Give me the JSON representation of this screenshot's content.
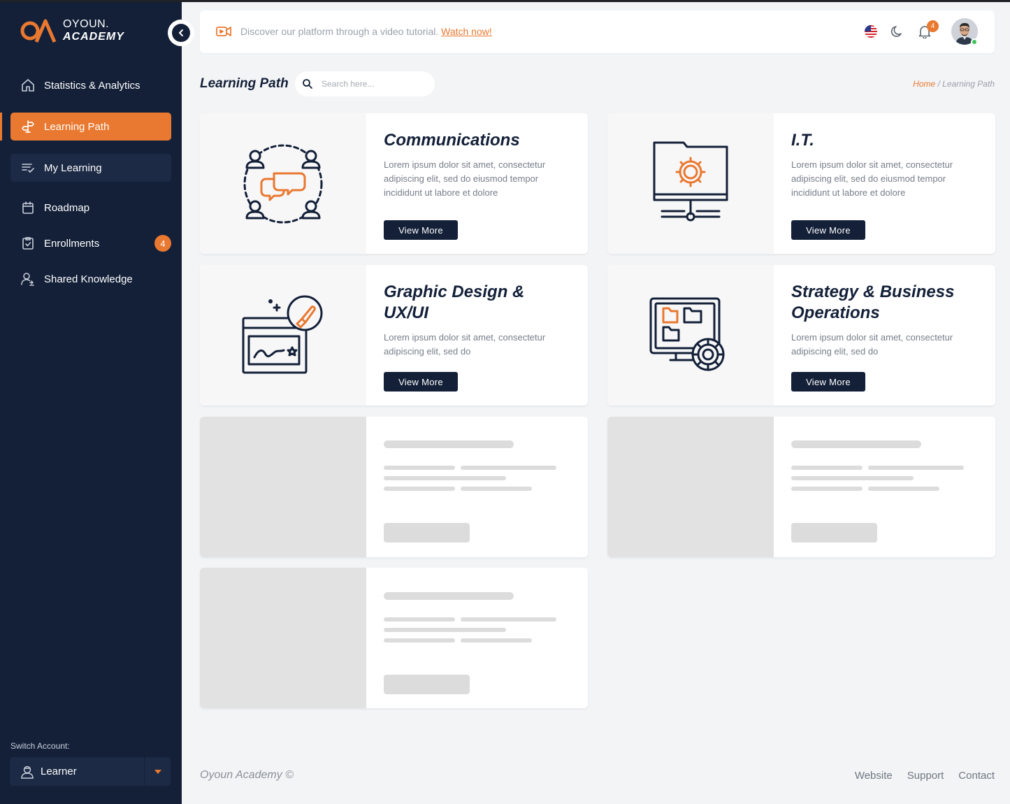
{
  "brand": {
    "line1": "OYOUN.",
    "line2": "ACADEMY"
  },
  "sidebar": {
    "items": [
      {
        "label": "Statistics & Analytics",
        "icon": "home-icon"
      },
      {
        "label": "Learning Path",
        "icon": "signpost-icon",
        "active": true
      },
      {
        "label": "My Learning",
        "icon": "list-check-icon"
      },
      {
        "label": "Roadmap",
        "icon": "calendar-icon"
      },
      {
        "label": "Enrollments",
        "icon": "clipboard-check-icon",
        "badge": "4"
      },
      {
        "label": "Shared Knowledge",
        "icon": "users-share-icon"
      }
    ],
    "switch_label": "Switch Account:",
    "account": "Learner"
  },
  "topbar": {
    "tutorial_text": "Discover our platform through a video tutorial.",
    "tutorial_link": "Watch now!",
    "notification_count": "4"
  },
  "header": {
    "title": "Learning Path",
    "search_placeholder": "Search here...",
    "breadcrumb_home": "Home",
    "breadcrumb_sep": "/",
    "breadcrumb_current": "Learning Path"
  },
  "cards": [
    {
      "title": "Communications",
      "desc": "Lorem ipsum dolor sit amet, consectetur adipiscing elit, sed do eiusmod tempor incididunt ut labore et dolore",
      "button": "View More",
      "icon": "communication-icon"
    },
    {
      "title": "I.T.",
      "desc": "Lorem ipsum dolor sit amet, consectetur adipiscing elit, sed do eiusmod tempor incididunt ut labore et dolore",
      "button": "View More",
      "icon": "computer-network-icon"
    },
    {
      "title": "Graphic Design & UX/UI",
      "desc": "Lorem ipsum dolor sit amet, consectetur adipiscing elit, sed do",
      "button": "View More",
      "icon": "design-brush-icon"
    },
    {
      "title": "Strategy & Business Operations",
      "desc": "Lorem ipsum dolor sit amet, consectetur adipiscing elit, sed do",
      "button": "View More",
      "icon": "operations-gear-icon"
    }
  ],
  "footer": {
    "brand": "Oyoun Academy ©",
    "links": [
      "Website",
      "Support",
      "Contact"
    ]
  },
  "colors": {
    "navy": "#132038",
    "accent": "#e97830",
    "background": "#f3f4f6"
  }
}
